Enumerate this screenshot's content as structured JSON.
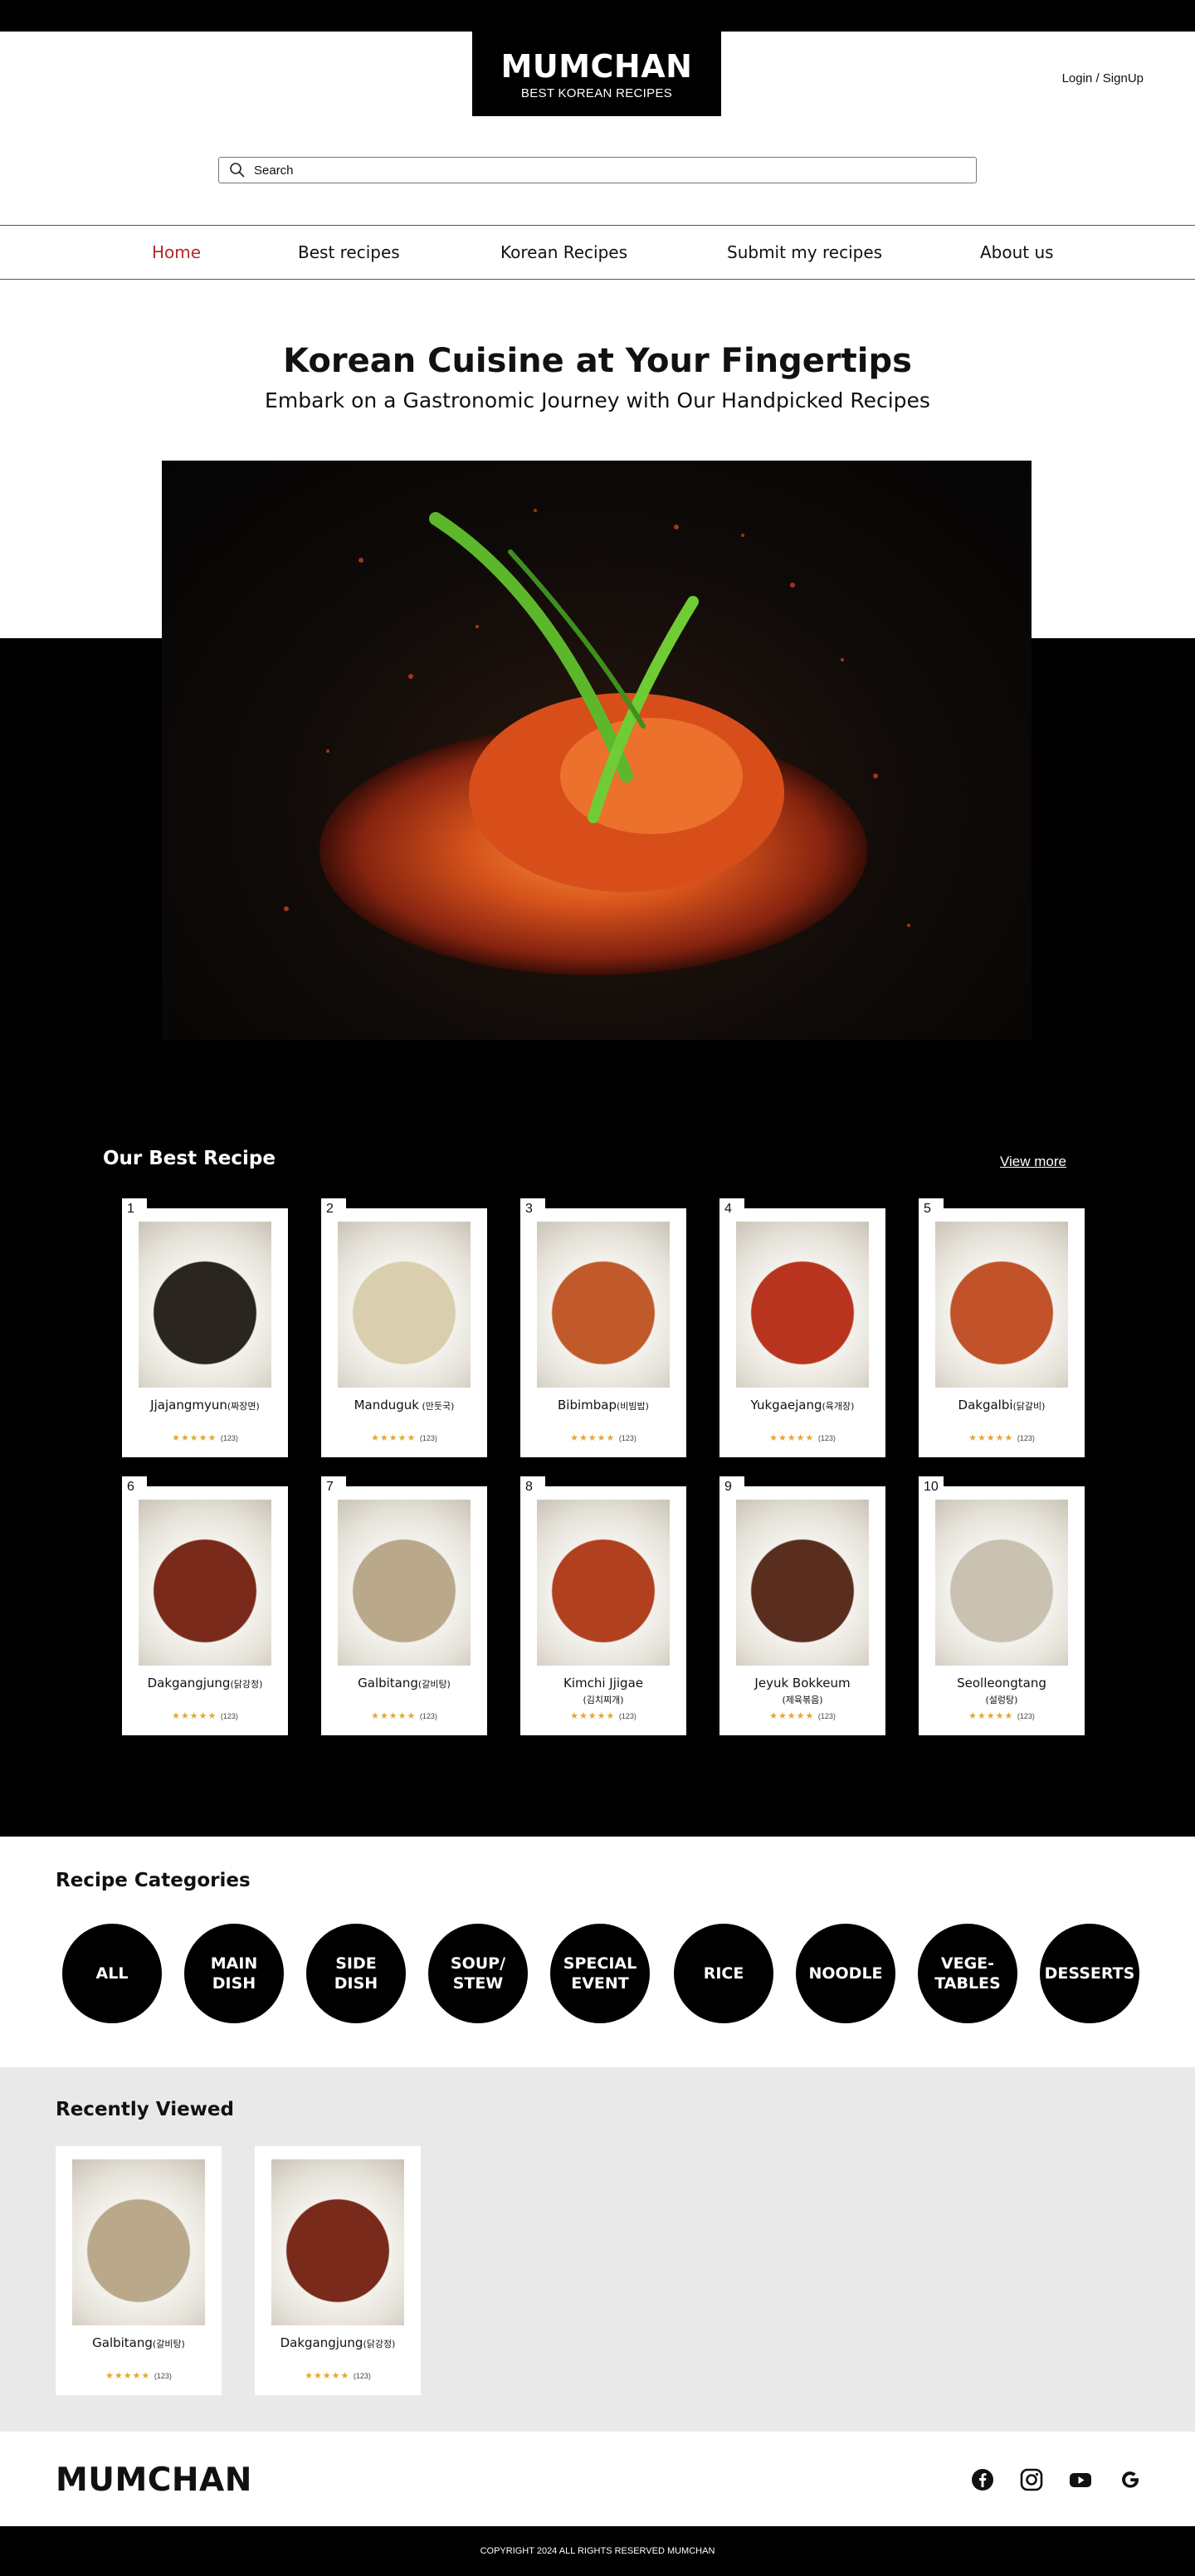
{
  "header": {
    "logo_title": "MUMCHAN",
    "logo_subtitle": "BEST KOREAN RECIPES",
    "login_label": "Login / SignUp"
  },
  "search": {
    "placeholder": "Search"
  },
  "nav": {
    "items": [
      {
        "label": "Home",
        "active": true
      },
      {
        "label": "Best recipes"
      },
      {
        "label": "Korean Recipes"
      },
      {
        "label": "Submit my recipes"
      },
      {
        "label": "About us"
      }
    ]
  },
  "hero": {
    "title": "Korean Cuisine at Your Fingertips",
    "subtitle": "Embark on a Gastronomic Journey with Our Handpicked Recipes"
  },
  "best": {
    "title": "Our Best Recipe",
    "view_more": "View more",
    "recipes": [
      {
        "rank": "1",
        "name": "Jjajangmyun",
        "korean": "(짜장면)",
        "stars": "★★★★★",
        "count": "(123)",
        "color": "#2b2520"
      },
      {
        "rank": "2",
        "name": "Manduguk",
        "korean": " (만둣국)",
        "stars": "★★★★★",
        "count": "(123)",
        "color": "#d9cfae"
      },
      {
        "rank": "3",
        "name": "Bibimbap",
        "korean": "(비빔밥)",
        "stars": "★★★★★",
        "count": "(123)",
        "color": "#c05a2a"
      },
      {
        "rank": "4",
        "name": "Yukgaejang",
        "korean": "(육개장)",
        "stars": "★★★★★",
        "count": "(123)",
        "color": "#b8341e"
      },
      {
        "rank": "5",
        "name": "Dakgalbi",
        "korean": "(닭갈비)",
        "stars": "★★★★★",
        "count": "(123)",
        "color": "#c2522a"
      },
      {
        "rank": "6",
        "name": "Dakgangjung",
        "korean": "(닭강정)",
        "stars": "★★★★★",
        "count": "(123)",
        "color": "#7a2a1a"
      },
      {
        "rank": "7",
        "name": "Galbitang",
        "korean": "(갈비탕)",
        "stars": "★★★★★",
        "count": "(123)",
        "color": "#b9a98a"
      },
      {
        "rank": "8",
        "name": "Kimchi Jjigae",
        "korean": "(김치찌개)",
        "stars": "★★★★★",
        "count": "(123)",
        "color": "#b0401e"
      },
      {
        "rank": "9",
        "name": "Jeyuk Bokkeum",
        "korean": "(제육볶음)",
        "stars": "★★★★★",
        "count": "(123)",
        "color": "#5a2e1e"
      },
      {
        "rank": "10",
        "name": "Seolleongtang",
        "korean": "(설렁탕)",
        "stars": "★★★★★",
        "count": "(123)",
        "color": "#c9c2b0"
      }
    ]
  },
  "categories": {
    "title": "Recipe Categories",
    "items": [
      "ALL",
      "MAIN\nDISH",
      "SIDE\nDISH",
      "SOUP/\nSTEW",
      "SPECIAL\nEVENT",
      "RICE",
      "NOODLE",
      "VEGE-\nTABLES",
      "DESSERTS"
    ]
  },
  "recent": {
    "title": "Recently Viewed",
    "items": [
      {
        "name": "Galbitang",
        "korean": "(갈비탕)",
        "stars": "★★★★★",
        "count": "(123)",
        "color": "#b9a98a"
      },
      {
        "name": "Dakgangjung",
        "korean": "(닭강정)",
        "stars": "★★★★★",
        "count": "(123)",
        "color": "#7a2a1a"
      }
    ]
  },
  "footer": {
    "logo": "MUMCHAN",
    "social": [
      "facebook-icon",
      "instagram-icon",
      "youtube-icon",
      "google-icon"
    ],
    "copyright": "COPYRIGHT 2024 ALL RIGHTS RESERVED MUMCHAN"
  }
}
